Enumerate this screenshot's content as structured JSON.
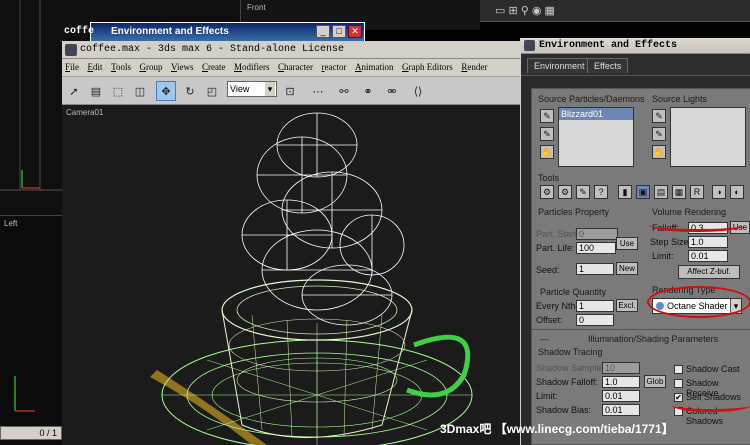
{
  "viewports": {
    "top_left_label": "",
    "front_label": "Front",
    "left_label": "Left",
    "camera_label": "Camera01",
    "frame_counter": "0 / 1"
  },
  "small_window": {
    "title": "Environment and Effects",
    "partial_text": "coffe"
  },
  "max_window": {
    "title": "coffee.max - 3ds max 6 - Stand-alone License",
    "menus": [
      "File",
      "Edit",
      "Tools",
      "Group",
      "Views",
      "Create",
      "Modifiers",
      "Character",
      "reactor",
      "Animation",
      "Graph Editors",
      "Render"
    ],
    "view_select": "View"
  },
  "env_dialog": {
    "title": "Environment and Effects",
    "tabs": [
      "Environment",
      "Effects"
    ],
    "source_particles_label": "Source Particles/Daemons",
    "source_lights_label": "Source Lights",
    "particles_list": [
      "Blizzard01"
    ],
    "tools_label": "Tools",
    "particles_property_label": "Particles Property",
    "part_start_label": "Part. Start",
    "part_start_value": "0",
    "part_life_label": "Part. Life:",
    "part_life_value": "100",
    "use_button": "Use",
    "seed_label": "Seed:",
    "seed_value": "1",
    "new_button": "New",
    "particle_quantity_label": "Particle Quantity",
    "every_nth_label": "Every Nth:",
    "every_nth_value": "1",
    "excl_button": "Excl.",
    "offset_label": "Offset:",
    "offset_value": "0",
    "volume_rendering_label": "Volume Rendering",
    "falloff_label": "Falloff:",
    "falloff_value": "0.3",
    "use_button_2": "Use",
    "step_size_label": "Step Size:",
    "step_size_value": "1.0",
    "limit_label": "Limit:",
    "limit_value": "0.01",
    "affect_z_buf": "Affect Z-buf.",
    "rendering_type_label": "Rendering Type",
    "rendering_type_value": "Octane Shader",
    "rollout_title": "Illumination/Shading Parameters",
    "shadow_tracing_label": "Shadow Tracing",
    "shadow_samples_label": "Shadow Samples",
    "shadow_samples_value": "10",
    "shadow_falloff_label": "Shadow Falloff:",
    "shadow_falloff_value": "1.0",
    "glob_button": "Glob",
    "limit2_label": "Limit:",
    "limit2_value": "0.01",
    "shadow_bias_label": "Shadow Bias:",
    "shadow_bias_value": "0.01",
    "shadow_cast_label": "Shadow Cast",
    "shadow_receive_label": "Shadow Receive",
    "self_shadows_label": "Self Shadows",
    "colored_shadows_label": "Colored Shadows",
    "self_shadows_checked": "✔"
  },
  "watermark": "3Dmax吧  【www.linecg.com/tieba/1771】",
  "colors": {
    "wire_white": "#ffffff",
    "wire_green": "#a8ff90",
    "mark_red": "#d01010",
    "spoon_gold": "#b08a20"
  }
}
